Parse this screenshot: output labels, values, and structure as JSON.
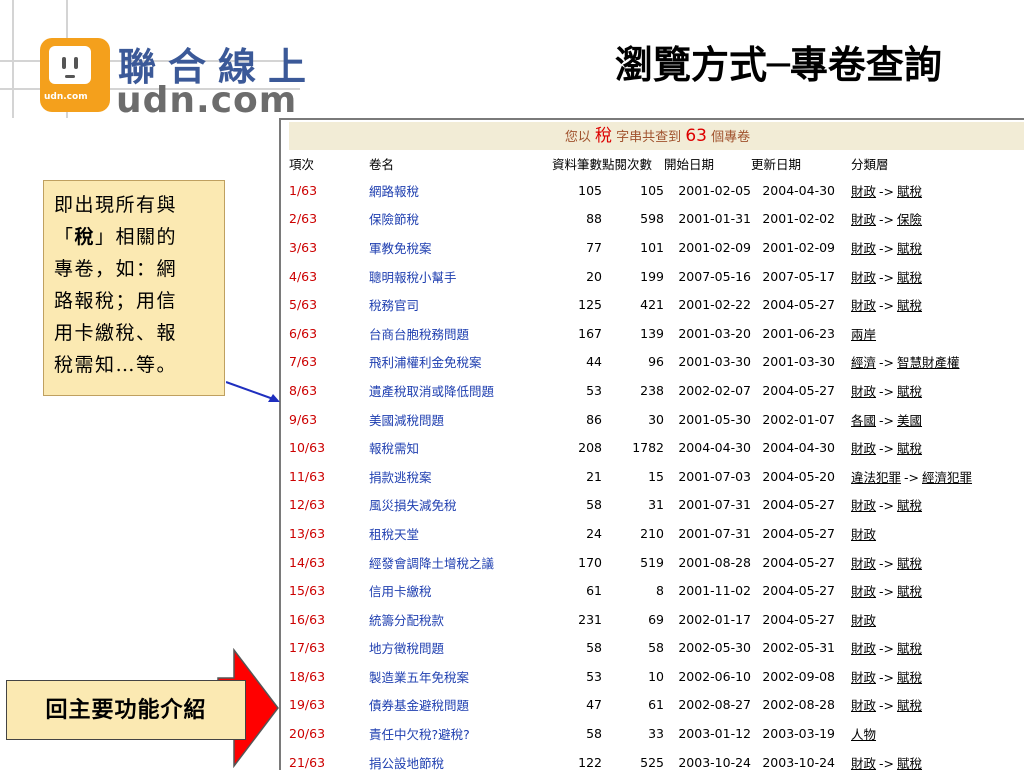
{
  "slide": {
    "title": "瀏覽方式─專卷查詢"
  },
  "logo": {
    "cn_text": "聯合線上",
    "en_text": "udn.com",
    "small_text": "udn.com"
  },
  "banner": {
    "prefix": "您以",
    "keyword": "稅",
    "middle": "字串共查到",
    "count": "63",
    "suffix": "個專卷"
  },
  "table": {
    "headers": [
      "項次",
      "卷名",
      "資料筆數",
      "點閱次數",
      "開始日期",
      "更新日期",
      "分類層"
    ],
    "rows": [
      {
        "idx": "1/63",
        "name": "網路報稅",
        "records": "105",
        "views": "105",
        "start": "2001-02-05",
        "update": "2004-04-30",
        "cat1": "財政",
        "cat2": "賦稅"
      },
      {
        "idx": "2/63",
        "name": "保險節稅",
        "records": "88",
        "views": "598",
        "start": "2001-01-31",
        "update": "2001-02-02",
        "cat1": "財政",
        "cat2": "保險"
      },
      {
        "idx": "3/63",
        "name": "軍教免稅案",
        "records": "77",
        "views": "101",
        "start": "2001-02-09",
        "update": "2001-02-09",
        "cat1": "財政",
        "cat2": "賦稅"
      },
      {
        "idx": "4/63",
        "name": "聰明報稅小幫手",
        "records": "20",
        "views": "199",
        "start": "2007-05-16",
        "update": "2007-05-17",
        "cat1": "財政",
        "cat2": "賦稅"
      },
      {
        "idx": "5/63",
        "name": "稅務官司",
        "records": "125",
        "views": "421",
        "start": "2001-02-22",
        "update": "2004-05-27",
        "cat1": "財政",
        "cat2": "賦稅"
      },
      {
        "idx": "6/63",
        "name": "台商台胞稅務問題",
        "records": "167",
        "views": "139",
        "start": "2001-03-20",
        "update": "2001-06-23",
        "cat1": "兩岸",
        "cat2": ""
      },
      {
        "idx": "7/63",
        "name": "飛利浦權利金免稅案",
        "records": "44",
        "views": "96",
        "start": "2001-03-30",
        "update": "2001-03-30",
        "cat1": "經濟",
        "cat2": "智慧財產權"
      },
      {
        "idx": "8/63",
        "name": "遺產稅取消或降低問題",
        "records": "53",
        "views": "238",
        "start": "2002-02-07",
        "update": "2004-05-27",
        "cat1": "財政",
        "cat2": "賦稅"
      },
      {
        "idx": "9/63",
        "name": "美國減稅問題",
        "records": "86",
        "views": "30",
        "start": "2001-05-30",
        "update": "2002-01-07",
        "cat1": "各國",
        "cat2": "美國"
      },
      {
        "idx": "10/63",
        "name": "報稅需知",
        "records": "208",
        "views": "1782",
        "start": "2004-04-30",
        "update": "2004-04-30",
        "cat1": "財政",
        "cat2": "賦稅"
      },
      {
        "idx": "11/63",
        "name": "捐款逃稅案",
        "records": "21",
        "views": "15",
        "start": "2001-07-03",
        "update": "2004-05-20",
        "cat1": "違法犯罪",
        "cat2": "經濟犯罪"
      },
      {
        "idx": "12/63",
        "name": "風災損失減免稅",
        "records": "58",
        "views": "31",
        "start": "2001-07-31",
        "update": "2004-05-27",
        "cat1": "財政",
        "cat2": "賦稅"
      },
      {
        "idx": "13/63",
        "name": "租稅天堂",
        "records": "24",
        "views": "210",
        "start": "2001-07-31",
        "update": "2004-05-27",
        "cat1": "財政",
        "cat2": ""
      },
      {
        "idx": "14/63",
        "name": "經發會調降土增稅之議",
        "records": "170",
        "views": "519",
        "start": "2001-08-28",
        "update": "2004-05-27",
        "cat1": "財政",
        "cat2": "賦稅"
      },
      {
        "idx": "15/63",
        "name": "信用卡繳稅",
        "records": "61",
        "views": "8",
        "start": "2001-11-02",
        "update": "2004-05-27",
        "cat1": "財政",
        "cat2": "賦稅"
      },
      {
        "idx": "16/63",
        "name": "統籌分配稅款",
        "records": "231",
        "views": "69",
        "start": "2002-01-17",
        "update": "2004-05-27",
        "cat1": "財政",
        "cat2": ""
      },
      {
        "idx": "17/63",
        "name": "地方徵稅問題",
        "records": "58",
        "views": "58",
        "start": "2002-05-30",
        "update": "2002-05-31",
        "cat1": "財政",
        "cat2": "賦稅"
      },
      {
        "idx": "18/63",
        "name": "製造業五年免稅案",
        "records": "53",
        "views": "10",
        "start": "2002-06-10",
        "update": "2002-09-08",
        "cat1": "財政",
        "cat2": "賦稅"
      },
      {
        "idx": "19/63",
        "name": "債券基金避稅問題",
        "records": "47",
        "views": "61",
        "start": "2002-08-27",
        "update": "2002-08-28",
        "cat1": "財政",
        "cat2": "賦稅"
      },
      {
        "idx": "20/63",
        "name": "責任中欠稅?避稅?",
        "records": "58",
        "views": "33",
        "start": "2003-01-12",
        "update": "2003-03-19",
        "cat1": "人物",
        "cat2": ""
      },
      {
        "idx": "21/63",
        "name": "捐公設地節稅",
        "records": "122",
        "views": "525",
        "start": "2003-10-24",
        "update": "2003-10-24",
        "cat1": "財政",
        "cat2": "賦稅"
      }
    ],
    "arrow_text": "->"
  },
  "callout": {
    "line1": "即出現所有與",
    "q_open": "「",
    "keyword": "稅",
    "q_close": "」",
    "line2_rest": "相關的",
    "line3": "專卷，如：網",
    "line4": "路報稅；用信",
    "line5": "用卡繳稅、報",
    "line6": "稅需知…等。"
  },
  "return_button": {
    "label": "回主要功能介紹"
  },
  "colors": {
    "callout_bg": "#fbe9b2",
    "banner_bg": "#f2ecd6",
    "index_red": "#cc0000",
    "name_blue": "#1f3fb0",
    "arrow_red": "#ff0000"
  }
}
